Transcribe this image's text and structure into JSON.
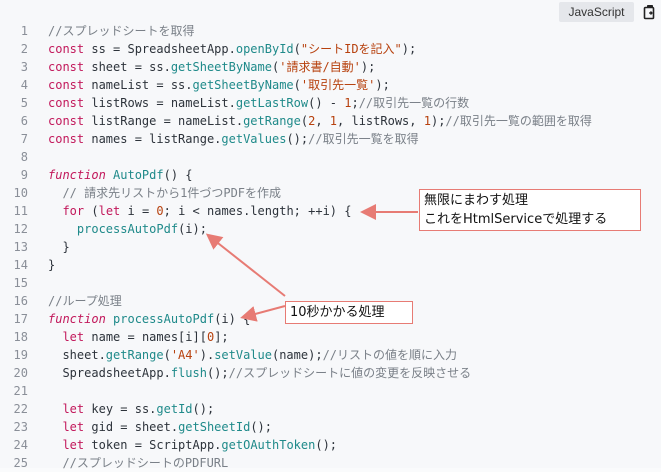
{
  "header": {
    "language": "JavaScript",
    "copy_icon": "copy-icon"
  },
  "code_lines": [
    {
      "n": "1",
      "t": [
        [
          "cm",
          "//スプレッドシートを取得"
        ]
      ]
    },
    {
      "n": "2",
      "t": [
        [
          "kw",
          "const"
        ],
        [
          "p",
          " ss = SpreadsheetApp."
        ],
        [
          "fn",
          "openById"
        ],
        [
          "p",
          "("
        ],
        [
          "str",
          "\"シートIDを記入\""
        ],
        [
          "p",
          ");"
        ]
      ]
    },
    {
      "n": "3",
      "t": [
        [
          "kw",
          "const"
        ],
        [
          "p",
          " sheet = ss."
        ],
        [
          "fn",
          "getSheetByName"
        ],
        [
          "p",
          "("
        ],
        [
          "str",
          "'請求書/自動'"
        ],
        [
          "p",
          ");"
        ]
      ]
    },
    {
      "n": "4",
      "t": [
        [
          "kw",
          "const"
        ],
        [
          "p",
          " nameList = ss."
        ],
        [
          "fn",
          "getSheetByName"
        ],
        [
          "p",
          "("
        ],
        [
          "str",
          "'取引先一覧'"
        ],
        [
          "p",
          ");"
        ]
      ]
    },
    {
      "n": "5",
      "t": [
        [
          "kw",
          "const"
        ],
        [
          "p",
          " listRows = nameList."
        ],
        [
          "fn",
          "getLastRow"
        ],
        [
          "p",
          "() - "
        ],
        [
          "num",
          "1"
        ],
        [
          "p",
          ";"
        ],
        [
          "cm",
          "//取引先一覧の行数"
        ]
      ]
    },
    {
      "n": "6",
      "t": [
        [
          "kw",
          "const"
        ],
        [
          "p",
          " listRange = nameList."
        ],
        [
          "fn",
          "getRange"
        ],
        [
          "p",
          "("
        ],
        [
          "num",
          "2"
        ],
        [
          "p",
          ", "
        ],
        [
          "num",
          "1"
        ],
        [
          "p",
          ", listRows, "
        ],
        [
          "num",
          "1"
        ],
        [
          "p",
          ");"
        ],
        [
          "cm",
          "//取引先一覧の範囲を取得"
        ]
      ]
    },
    {
      "n": "7",
      "t": [
        [
          "kw",
          "const"
        ],
        [
          "p",
          " names = listRange."
        ],
        [
          "fn",
          "getValues"
        ],
        [
          "p",
          "();"
        ],
        [
          "cm",
          "//取引先一覧を取得"
        ]
      ]
    },
    {
      "n": "8",
      "t": []
    },
    {
      "n": "9",
      "t": [
        [
          "kwi",
          "function"
        ],
        [
          "p",
          " "
        ],
        [
          "fn",
          "AutoPdf"
        ],
        [
          "p",
          "() {"
        ]
      ]
    },
    {
      "n": "10",
      "t": [
        [
          "p",
          "  "
        ],
        [
          "cm",
          "// 請求先リストから1件づつPDFを作成"
        ]
      ]
    },
    {
      "n": "11",
      "t": [
        [
          "p",
          "  "
        ],
        [
          "kw",
          "for"
        ],
        [
          "p",
          " ("
        ],
        [
          "kw",
          "let"
        ],
        [
          "p",
          " i = "
        ],
        [
          "num",
          "0"
        ],
        [
          "p",
          "; i < names.length; ++i) {"
        ]
      ]
    },
    {
      "n": "12",
      "t": [
        [
          "p",
          "    "
        ],
        [
          "fn",
          "processAutoPdf"
        ],
        [
          "p",
          "(i);"
        ]
      ]
    },
    {
      "n": "13",
      "t": [
        [
          "p",
          "  }"
        ]
      ]
    },
    {
      "n": "14",
      "t": [
        [
          "p",
          "}"
        ]
      ]
    },
    {
      "n": "15",
      "t": []
    },
    {
      "n": "16",
      "t": [
        [
          "cm",
          "//ループ処理"
        ]
      ]
    },
    {
      "n": "17",
      "t": [
        [
          "kwi",
          "function"
        ],
        [
          "p",
          " "
        ],
        [
          "fn",
          "processAutoPdf"
        ],
        [
          "p",
          "(i) {"
        ]
      ]
    },
    {
      "n": "18",
      "t": [
        [
          "p",
          "  "
        ],
        [
          "kw",
          "let"
        ],
        [
          "p",
          " name = names[i]["
        ],
        [
          "num",
          "0"
        ],
        [
          "p",
          "];"
        ]
      ]
    },
    {
      "n": "19",
      "t": [
        [
          "p",
          "  sheet."
        ],
        [
          "fn",
          "getRange"
        ],
        [
          "p",
          "("
        ],
        [
          "str",
          "'A4'"
        ],
        [
          "p",
          ")."
        ],
        [
          "fn",
          "setValue"
        ],
        [
          "p",
          "(name);"
        ],
        [
          "cm",
          "//リストの値を順に入力"
        ]
      ]
    },
    {
      "n": "20",
      "t": [
        [
          "p",
          "  SpreadsheetApp."
        ],
        [
          "fn",
          "flush"
        ],
        [
          "p",
          "();"
        ],
        [
          "cm",
          "//スプレッドシートに値の変更を反映させる"
        ]
      ]
    },
    {
      "n": "21",
      "t": []
    },
    {
      "n": "22",
      "t": [
        [
          "p",
          "  "
        ],
        [
          "kw",
          "let"
        ],
        [
          "p",
          " key = ss."
        ],
        [
          "fn",
          "getId"
        ],
        [
          "p",
          "();"
        ]
      ]
    },
    {
      "n": "23",
      "t": [
        [
          "p",
          "  "
        ],
        [
          "kw",
          "let"
        ],
        [
          "p",
          " gid = sheet."
        ],
        [
          "fn",
          "getSheetId"
        ],
        [
          "p",
          "();"
        ]
      ]
    },
    {
      "n": "24",
      "t": [
        [
          "p",
          "  "
        ],
        [
          "kw",
          "let"
        ],
        [
          "p",
          " token = ScriptApp."
        ],
        [
          "fn",
          "getOAuthToken"
        ],
        [
          "p",
          "();"
        ]
      ]
    },
    {
      "n": "25",
      "t": [
        [
          "p",
          "  "
        ],
        [
          "cm",
          "//スプレッドシートのPDFURL"
        ]
      ]
    }
  ],
  "callouts": {
    "loop": {
      "line1": "無限にまわす処理",
      "line2": "これをHtmlServiceで処理する"
    },
    "time": {
      "text": "10秒かかる処理"
    }
  },
  "colors": {
    "arrow": "#e77b74"
  }
}
